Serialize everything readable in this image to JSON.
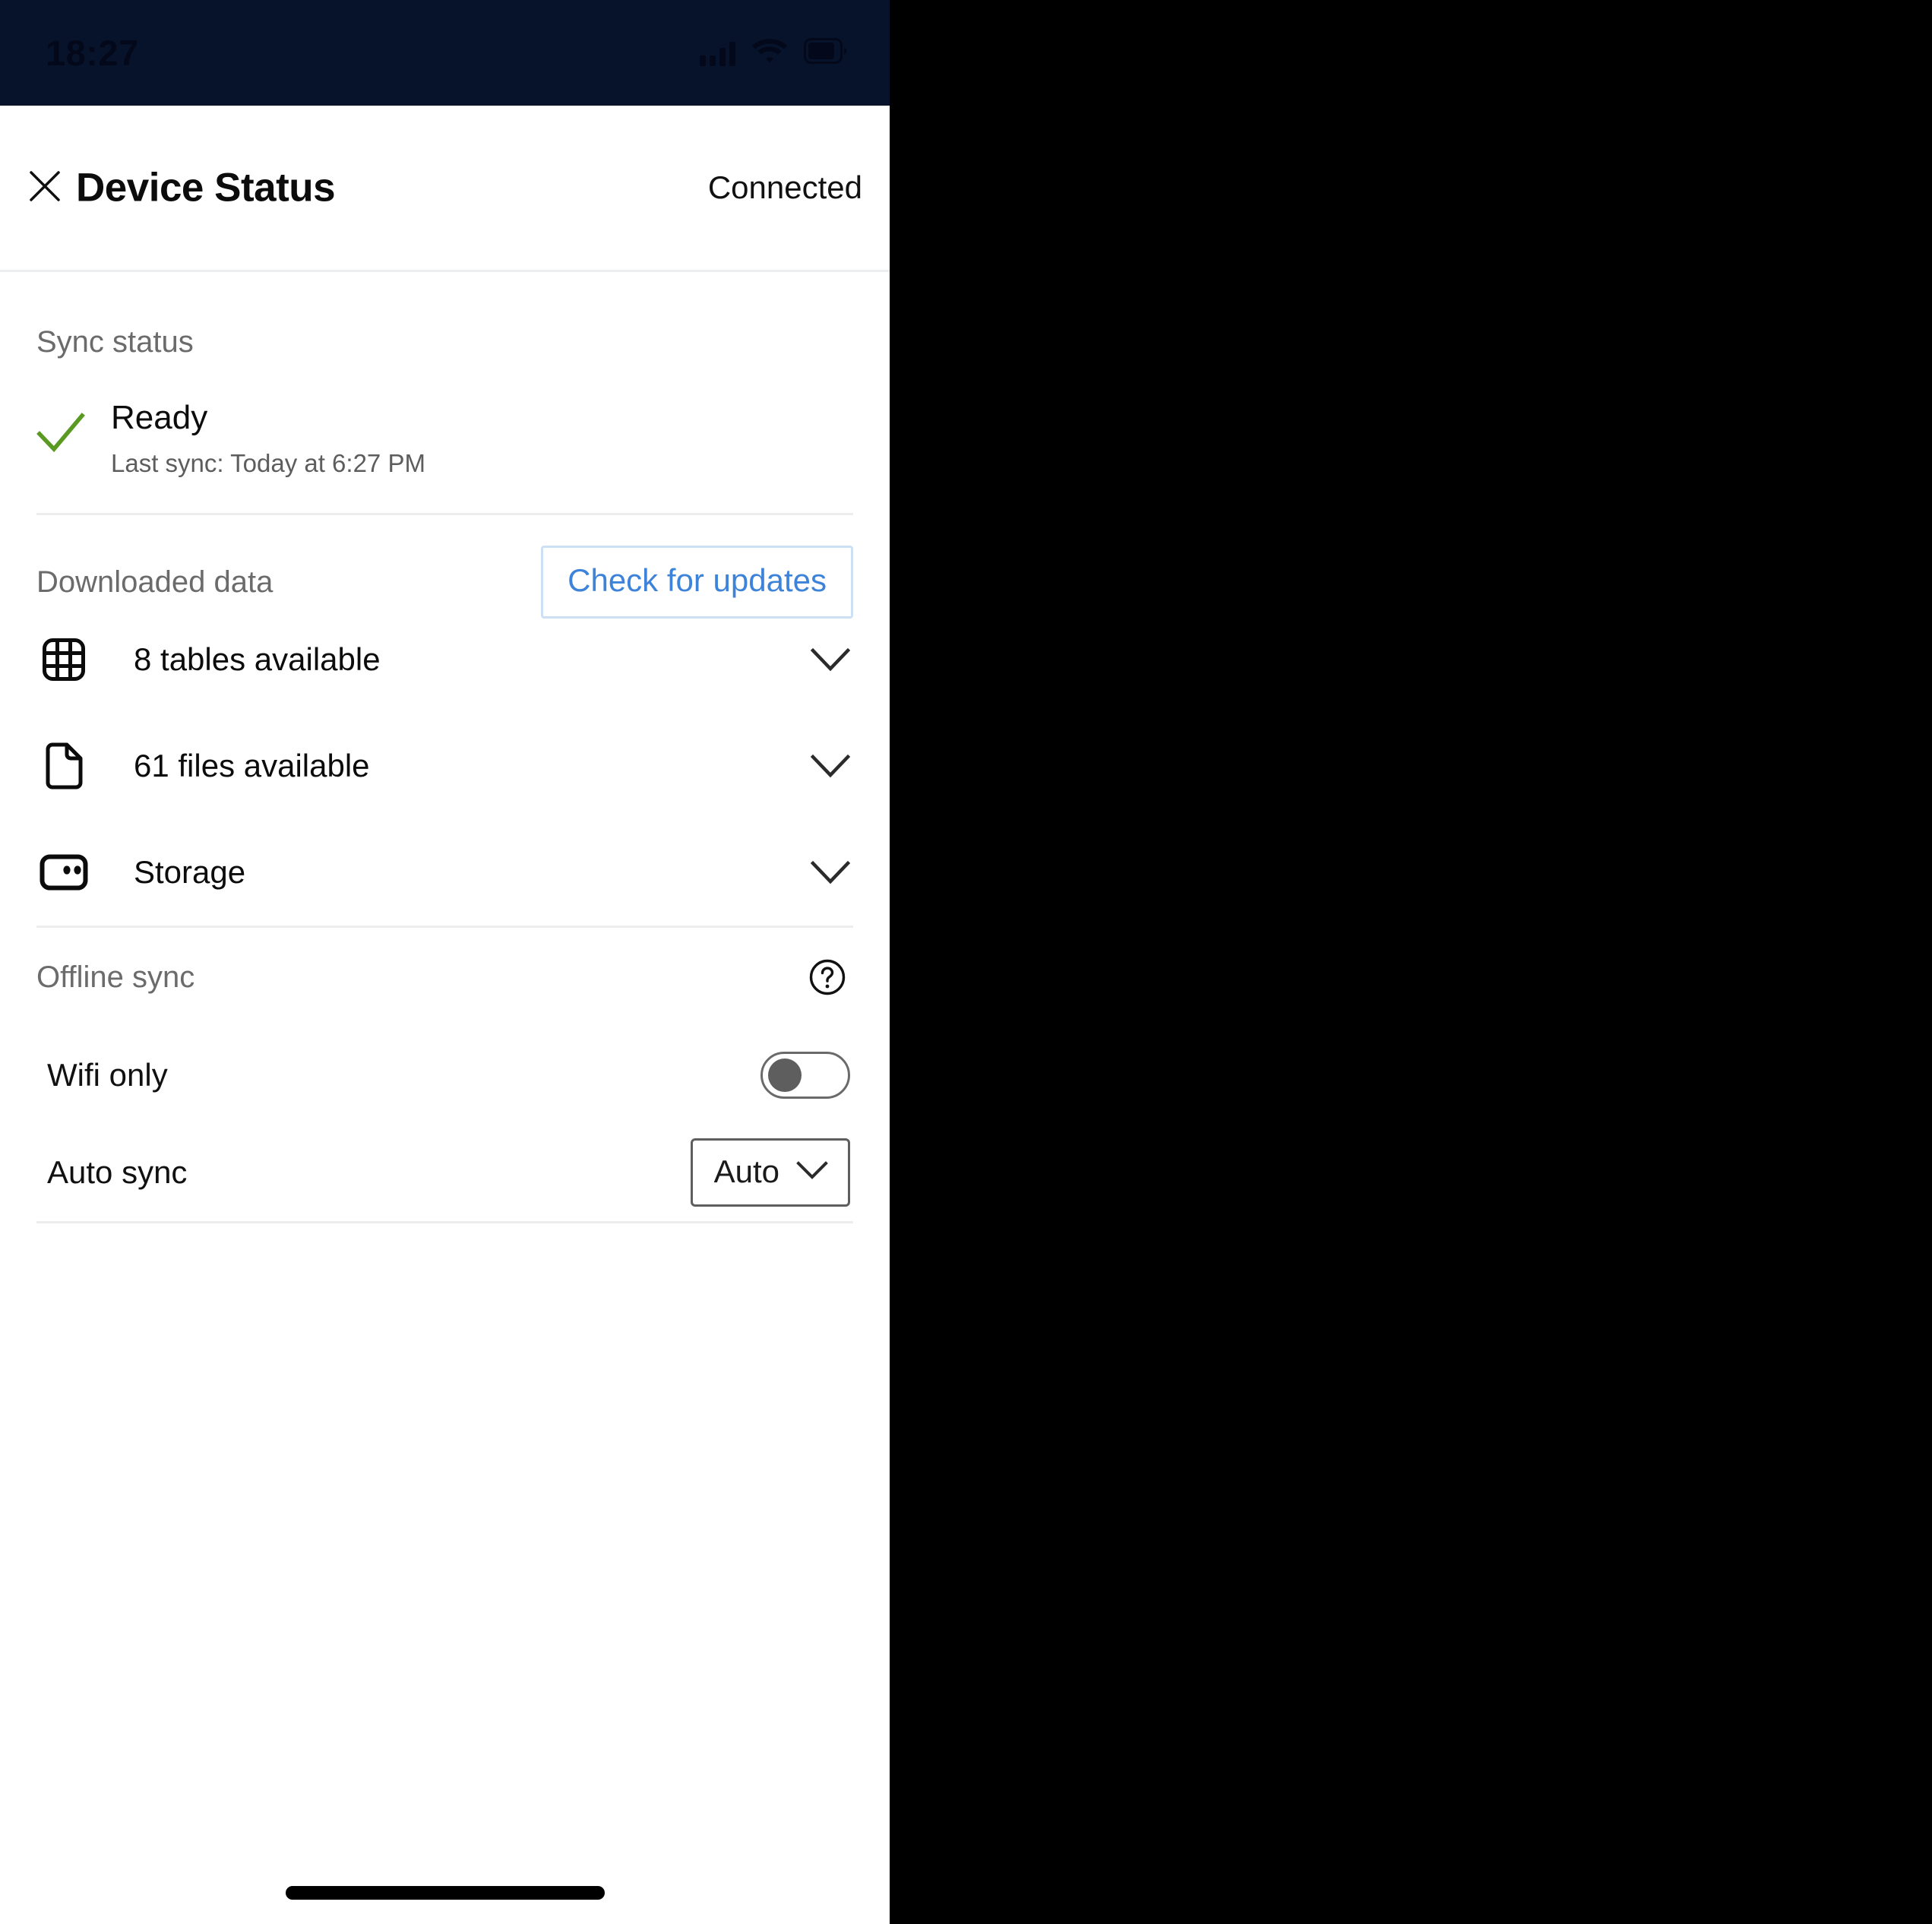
{
  "status_bar": {
    "time": "18:27",
    "icons": [
      "signal-bars-icon",
      "wifi-icon",
      "battery-icon"
    ],
    "background_color": "#07132b"
  },
  "header": {
    "close_icon": "close-icon",
    "title": "Device Status",
    "connection_status": "Connected"
  },
  "sync_status": {
    "section_label": "Sync status",
    "state_icon": "check-icon",
    "state_color": "#5a9a22",
    "state": "Ready",
    "last_sync": "Last sync: Today at 6:27 PM"
  },
  "downloaded_data": {
    "section_label": "Downloaded data",
    "check_updates_label": "Check for updates",
    "accent_color": "#3d83d9",
    "rows": [
      {
        "icon": "table-grid-icon",
        "label": "8 tables available",
        "chevron": "chevron-down-icon"
      },
      {
        "icon": "file-document-icon",
        "label": "61 files available",
        "chevron": "chevron-down-icon"
      },
      {
        "icon": "storage-drive-icon",
        "label": "Storage",
        "chevron": "chevron-down-icon"
      }
    ]
  },
  "offline_sync": {
    "section_label": "Offline sync",
    "help_icon": "help-circle-icon",
    "wifi_only": {
      "label": "Wifi only",
      "toggle_state": "off"
    },
    "auto_sync": {
      "label": "Auto sync",
      "selected_option": "Auto",
      "chevron": "chevron-down-icon"
    }
  }
}
